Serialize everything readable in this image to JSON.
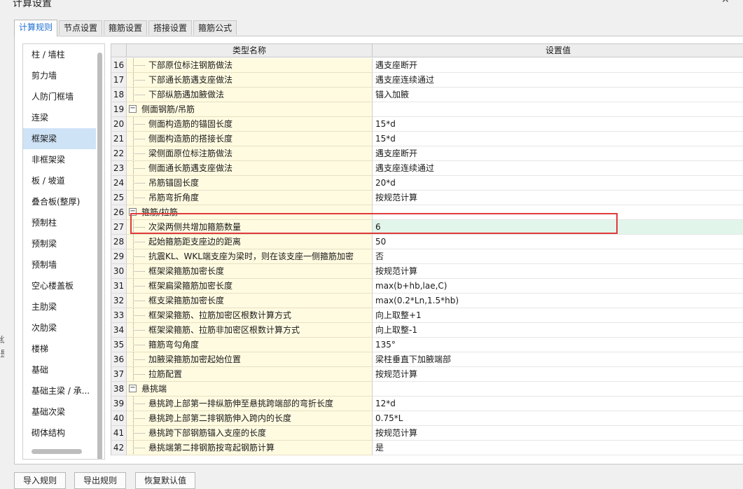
{
  "window": {
    "title": "计算设置"
  },
  "tabs": [
    {
      "label": "计算规则"
    },
    {
      "label": "节点设置"
    },
    {
      "label": "箍筋设置"
    },
    {
      "label": "搭接设置"
    },
    {
      "label": "箍筋公式"
    }
  ],
  "active_tab": "计算规则",
  "sidebar": {
    "selected": "框架梁",
    "items": [
      {
        "label": "柱 / 墙柱"
      },
      {
        "label": "剪力墙"
      },
      {
        "label": "人防门框墙"
      },
      {
        "label": "连梁"
      },
      {
        "label": "框架梁"
      },
      {
        "label": "非框架梁"
      },
      {
        "label": "板 / 坡道"
      },
      {
        "label": "叠合板(整厚)"
      },
      {
        "label": "预制柱"
      },
      {
        "label": "预制梁"
      },
      {
        "label": "预制墙"
      },
      {
        "label": "空心楼盖板"
      },
      {
        "label": "主肋梁"
      },
      {
        "label": "次肋梁"
      },
      {
        "label": "楼梯"
      },
      {
        "label": "基础"
      },
      {
        "label": "基础主梁 / 承..."
      },
      {
        "label": "基础次梁"
      },
      {
        "label": "砌体结构"
      }
    ]
  },
  "grid": {
    "columns": {
      "name": "类型名称",
      "value": "设置值"
    },
    "selected_row": "27",
    "rows": [
      {
        "num": "16",
        "name": "下部原位标注钢筋做法",
        "value": "遇支座断开",
        "group": false
      },
      {
        "num": "17",
        "name": "下部通长筋遇支座做法",
        "value": "遇支座连续通过",
        "group": false
      },
      {
        "num": "18",
        "name": "下部纵筋遇加腋做法",
        "value": "锚入加腋",
        "group": false
      },
      {
        "num": "19",
        "name": "侧面钢筋/吊筋",
        "value": "",
        "group": true
      },
      {
        "num": "20",
        "name": "侧面构造筋的锚固长度",
        "value": "15*d",
        "group": false
      },
      {
        "num": "21",
        "name": "侧面构造筋的搭接长度",
        "value": "15*d",
        "group": false
      },
      {
        "num": "22",
        "name": "梁侧面原位标注筋做法",
        "value": "遇支座断开",
        "group": false
      },
      {
        "num": "23",
        "name": "侧面通长筋遇支座做法",
        "value": "遇支座连续通过",
        "group": false
      },
      {
        "num": "24",
        "name": "吊筋锚固长度",
        "value": "20*d",
        "group": false
      },
      {
        "num": "25",
        "name": "吊筋弯折角度",
        "value": "按规范计算",
        "group": false
      },
      {
        "num": "26",
        "name": "箍筋/拉筋",
        "value": "",
        "group": true
      },
      {
        "num": "27",
        "name": "次梁两侧共增加箍筋数量",
        "value": "6",
        "group": false
      },
      {
        "num": "28",
        "name": "起始箍筋距支座边的距离",
        "value": "50",
        "group": false
      },
      {
        "num": "29",
        "name": "抗震KL、WKL端支座为梁时，则在该支座一侧箍筋加密",
        "value": "否",
        "group": false
      },
      {
        "num": "30",
        "name": "框架梁箍筋加密长度",
        "value": "按规范计算",
        "group": false
      },
      {
        "num": "31",
        "name": "框架扁梁箍筋加密长度",
        "value": "max(b+hb,lae,C)",
        "group": false
      },
      {
        "num": "32",
        "name": "框支梁箍筋加密长度",
        "value": "max(0.2*Ln,1.5*hb)",
        "group": false
      },
      {
        "num": "33",
        "name": "框架梁箍筋、拉筋加密区根数计算方式",
        "value": "向上取整+1",
        "group": false
      },
      {
        "num": "34",
        "name": "框架梁箍筋、拉筋非加密区根数计算方式",
        "value": "向上取整-1",
        "group": false
      },
      {
        "num": "35",
        "name": "箍筋弯勾角度",
        "value": "135°",
        "group": false
      },
      {
        "num": "36",
        "name": "加腋梁箍筋加密起始位置",
        "value": "梁柱垂直下加腋端部",
        "group": false
      },
      {
        "num": "37",
        "name": "拉筋配置",
        "value": "按规范计算",
        "group": false
      },
      {
        "num": "38",
        "name": "悬挑端",
        "value": "",
        "group": true
      },
      {
        "num": "39",
        "name": "悬挑跨上部第一排纵筋伸至悬挑跨端部的弯折长度",
        "value": "12*d",
        "group": false
      },
      {
        "num": "40",
        "name": "悬挑跨上部第二排钢筋伸入跨内的长度",
        "value": "0.75*L",
        "group": false
      },
      {
        "num": "41",
        "name": "悬挑跨下部钢筋锚入支座的长度",
        "value": "按规范计算",
        "group": false
      },
      {
        "num": "42",
        "name": "悬挑端第二排钢筋按弯起钢筋计算",
        "value": "是",
        "group": false
      }
    ]
  },
  "toggle_symbol": "−",
  "buttons": {
    "import": "导入规则",
    "export": "导出规则",
    "restore": "恢复默认值"
  },
  "left_edge_fragments": [
    "刂",
    "纺",
    "昰"
  ],
  "colors": {
    "active_tab_text": "#1e6fd0",
    "name_cell_bg": "#fffbe1",
    "selected_value_bg": "#e2f5ea",
    "selected_sidebar_bg": "#cfe3f7",
    "highlight_box": "#e03a3a"
  }
}
